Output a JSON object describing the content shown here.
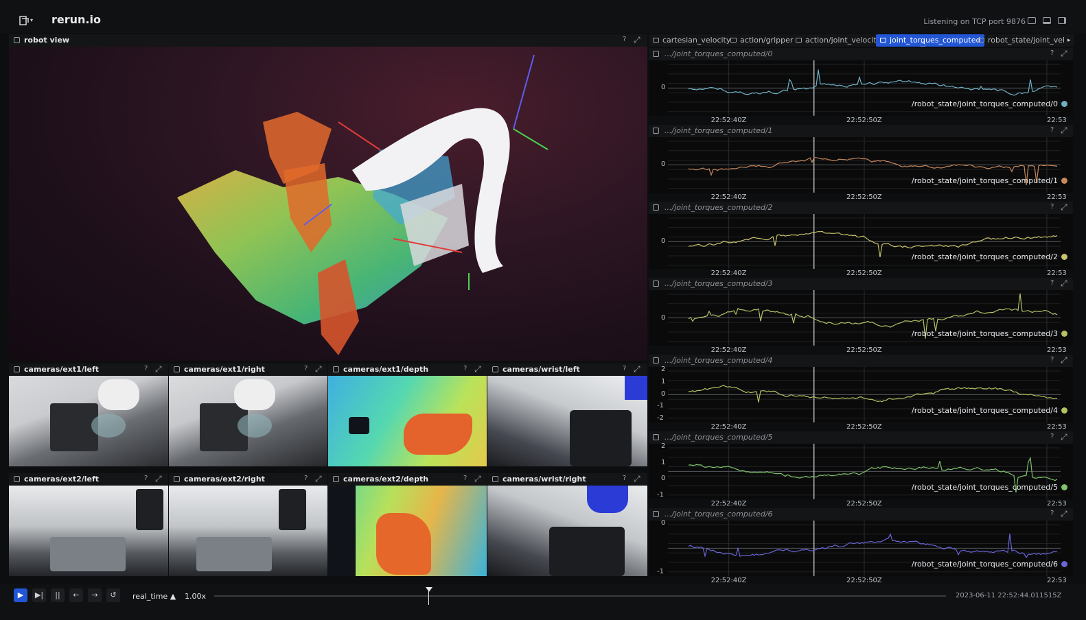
{
  "app": {
    "title": "rerun.io",
    "status": "Listening on TCP port 9876"
  },
  "robot_view": {
    "title": "robot view",
    "help": "?"
  },
  "cameras": [
    {
      "title": "cameras/ext1/left"
    },
    {
      "title": "cameras/ext1/right"
    },
    {
      "title": "cameras/ext1/depth"
    },
    {
      "title": "cameras/wrist/left"
    },
    {
      "title": "cameras/ext2/left"
    },
    {
      "title": "cameras/ext2/right"
    },
    {
      "title": "cameras/ext2/depth"
    },
    {
      "title": "cameras/wrist/right"
    }
  ],
  "tabs": [
    {
      "label": "cartesian_velocity"
    },
    {
      "label": "action/gripper"
    },
    {
      "label": "action/joint_velocity"
    },
    {
      "label": "joint_torques_computed",
      "active": true
    },
    {
      "label": "robot_state/joint_vel"
    }
  ],
  "plots": [
    {
      "title": ".../joint_torques_computed/0",
      "legend": "/robot_state/joint_torques_computed/0",
      "color": "#6fb1c4",
      "yticks": [
        "0"
      ]
    },
    {
      "title": ".../joint_torques_computed/1",
      "legend": "/robot_state/joint_torques_computed/1",
      "color": "#c8885a",
      "yticks": [
        "0"
      ]
    },
    {
      "title": ".../joint_torques_computed/2",
      "legend": "/robot_state/joint_torques_computed/2",
      "color": "#c9c46a",
      "yticks": [
        "0"
      ]
    },
    {
      "title": ".../joint_torques_computed/3",
      "legend": "/robot_state/joint_torques_computed/3",
      "color": "#b6c064",
      "yticks": [
        "0"
      ]
    },
    {
      "title": ".../joint_torques_computed/4",
      "legend": "/robot_state/joint_torques_computed/4",
      "color": "#b2c35e",
      "yticks": [
        "2",
        "1",
        "0",
        "-1",
        "-2"
      ]
    },
    {
      "title": ".../joint_torques_computed/5",
      "legend": "/robot_state/joint_torques_computed/5",
      "color": "#7fc46a",
      "yticks": [
        "2",
        "1",
        "0",
        "-1"
      ]
    },
    {
      "title": ".../joint_torques_computed/6",
      "legend": "/robot_state/joint_torques_computed/6",
      "color": "#6a66d6",
      "yticks": [
        "0",
        "-1"
      ]
    }
  ],
  "x_ticks": [
    "22:52:40Z",
    "22:52:50Z",
    "22:53"
  ],
  "timeline": {
    "timeline_name": "real_time",
    "speed": "1.00x",
    "current_time": "2023-06-11 22:52:44.011515Z"
  },
  "colors": {
    "accent": "#2256d6",
    "background": "#0d0e0f"
  }
}
